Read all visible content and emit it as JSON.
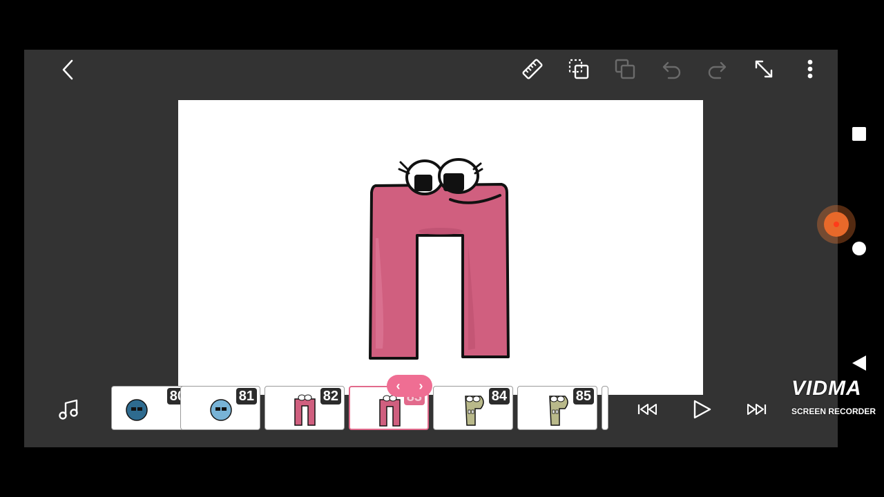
{
  "toolbar": {
    "icons": [
      "back-icon",
      "ruler-icon",
      "copy-frame-icon",
      "paste-frame-icon",
      "undo-icon",
      "redo-icon",
      "expand-icon",
      "more-icon"
    ]
  },
  "timeline": {
    "frames": [
      {
        "number": "80",
        "thumb": "blue-ball"
      },
      {
        "number": "81",
        "thumb": "light-blue-ball"
      },
      {
        "number": "82",
        "thumb": "pink-letter"
      },
      {
        "number": "83",
        "thumb": "pink-letter",
        "selected": true
      },
      {
        "number": "84",
        "thumb": "green-letter"
      },
      {
        "number": "85",
        "thumb": "green-letter"
      }
    ],
    "nav_prev": "‹",
    "nav_next": "›"
  },
  "playback": {
    "icons": [
      "music-icon",
      "skip-to-start-icon",
      "play-icon",
      "skip-to-end-icon"
    ]
  },
  "watermark": {
    "logo": "VIDMA",
    "subtitle": "SCREEN RECORDER"
  },
  "colors": {
    "app_bg": "#333333",
    "canvas_bg": "#ffffff",
    "accent": "#e26a8c",
    "letter_pink": "#d05f7f"
  }
}
